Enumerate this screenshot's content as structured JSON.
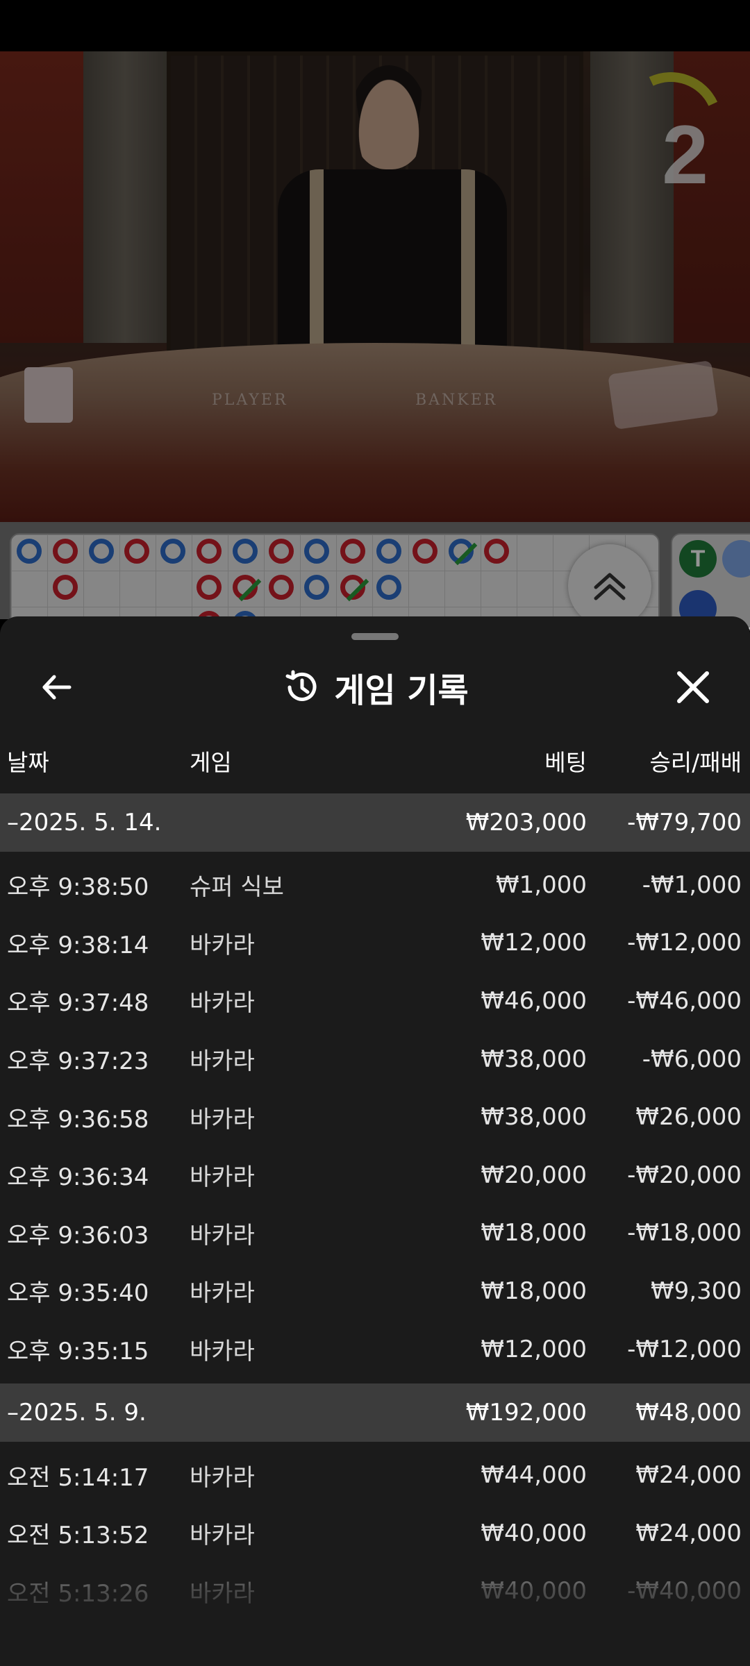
{
  "video": {
    "table_labels": [
      "PLAYER",
      "BANKER"
    ],
    "timer_value": "2"
  },
  "roadmap": {
    "tie_badge": "T",
    "accent_colors": {
      "banker": "#c81f2b",
      "player": "#2d6cc9",
      "tie": "#2a9b3b"
    }
  },
  "sheet": {
    "title": "게임 기록",
    "icons": {
      "back": "back-arrow-icon",
      "history": "history-icon",
      "close": "close-icon"
    },
    "columns": {
      "date": "날짜",
      "game": "게임",
      "bet": "베팅",
      "win_loss": "승리/패배"
    },
    "groups": [
      {
        "date": "–2025. 5. 14.",
        "total_bet": "₩203,000",
        "total_result": "-₩79,700",
        "rows": [
          {
            "time": "오후 9:38:50",
            "game": "슈퍼 식보",
            "bet": "₩1,000",
            "result": "-₩1,000"
          },
          {
            "time": "오후 9:38:14",
            "game": "바카라",
            "bet": "₩12,000",
            "result": "-₩12,000"
          },
          {
            "time": "오후 9:37:48",
            "game": "바카라",
            "bet": "₩46,000",
            "result": "-₩46,000"
          },
          {
            "time": "오후 9:37:23",
            "game": "바카라",
            "bet": "₩38,000",
            "result": "-₩6,000"
          },
          {
            "time": "오후 9:36:58",
            "game": "바카라",
            "bet": "₩38,000",
            "result": "₩26,000"
          },
          {
            "time": "오후 9:36:34",
            "game": "바카라",
            "bet": "₩20,000",
            "result": "-₩20,000"
          },
          {
            "time": "오후 9:36:03",
            "game": "바카라",
            "bet": "₩18,000",
            "result": "-₩18,000"
          },
          {
            "time": "오후 9:35:40",
            "game": "바카라",
            "bet": "₩18,000",
            "result": "₩9,300"
          },
          {
            "time": "오후 9:35:15",
            "game": "바카라",
            "bet": "₩12,000",
            "result": "-₩12,000"
          }
        ]
      },
      {
        "date": "–2025. 5. 9.",
        "total_bet": "₩192,000",
        "total_result": "₩48,000",
        "rows": [
          {
            "time": "오전 5:14:17",
            "game": "바카라",
            "bet": "₩44,000",
            "result": "₩24,000"
          },
          {
            "time": "오전 5:13:52",
            "game": "바카라",
            "bet": "₩40,000",
            "result": "₩24,000"
          },
          {
            "time": "오전 5:13:26",
            "game": "바카라",
            "bet": "₩40,000",
            "result": "-₩40,000"
          }
        ]
      }
    ]
  }
}
